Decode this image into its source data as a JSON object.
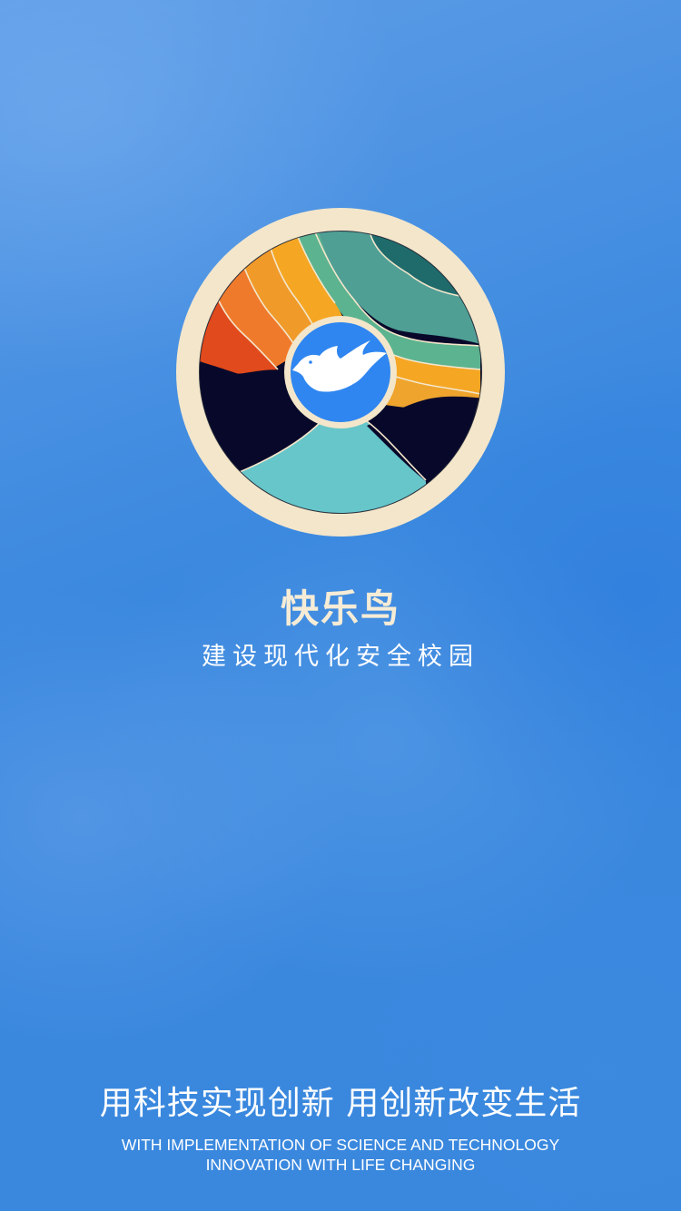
{
  "app": {
    "name": "快乐鸟",
    "tagline": "建设现代化安全校园"
  },
  "logo": {
    "icon": "dove-wheel-logo-icon",
    "colors": {
      "ring": "#f3e6cb",
      "center": "#2f86f0",
      "dove": "#ffffff",
      "dark": "#08092a",
      "teal": "#66c6c9",
      "green": "#5cb38f",
      "deep_teal": "#1f6b6b",
      "orange": "#f5a623",
      "red_orange": "#e04a1c"
    }
  },
  "slogan": {
    "chinese": "用科技实现创新  用创新改变生活",
    "english_line1": "WITH IMPLEMENTATION OF SCIENCE AND TECHNOLOGY",
    "english_line2": "INNOVATION WITH LIFE CHANGING"
  },
  "theme": {
    "background": "#3a88de",
    "title_color": "#f6ecd6"
  }
}
